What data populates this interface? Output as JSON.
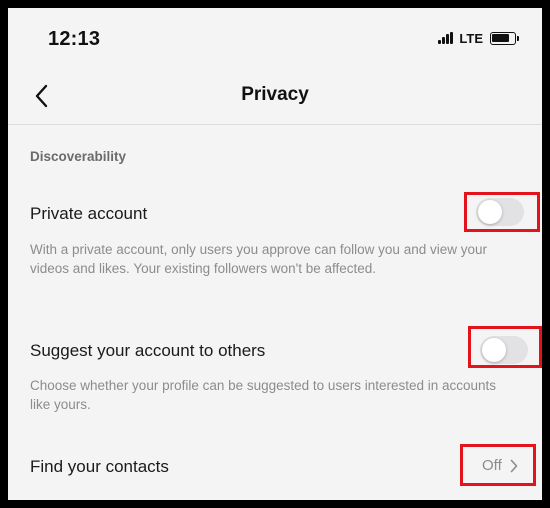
{
  "status_bar": {
    "time": "12:13",
    "network": "LTE"
  },
  "header": {
    "title": "Privacy",
    "back_icon": "chevron-left-icon"
  },
  "section": {
    "label": "Discoverability"
  },
  "settings": {
    "private_account": {
      "title": "Private account",
      "description": "With a private account, only users you approve can follow you and view your videos and likes. Your existing followers won't be affected.",
      "enabled": false
    },
    "suggest_account": {
      "title": "Suggest your account to others",
      "description": "Choose whether your profile can be suggested to users interested in accounts like yours.",
      "enabled": false
    },
    "find_contacts": {
      "title": "Find your contacts",
      "value": "Off",
      "chevron_icon": "chevron-right-icon"
    }
  },
  "colors": {
    "highlight": "#e3131b",
    "background": "#f4f4f5",
    "toggle_off": "#e2e2e4"
  }
}
